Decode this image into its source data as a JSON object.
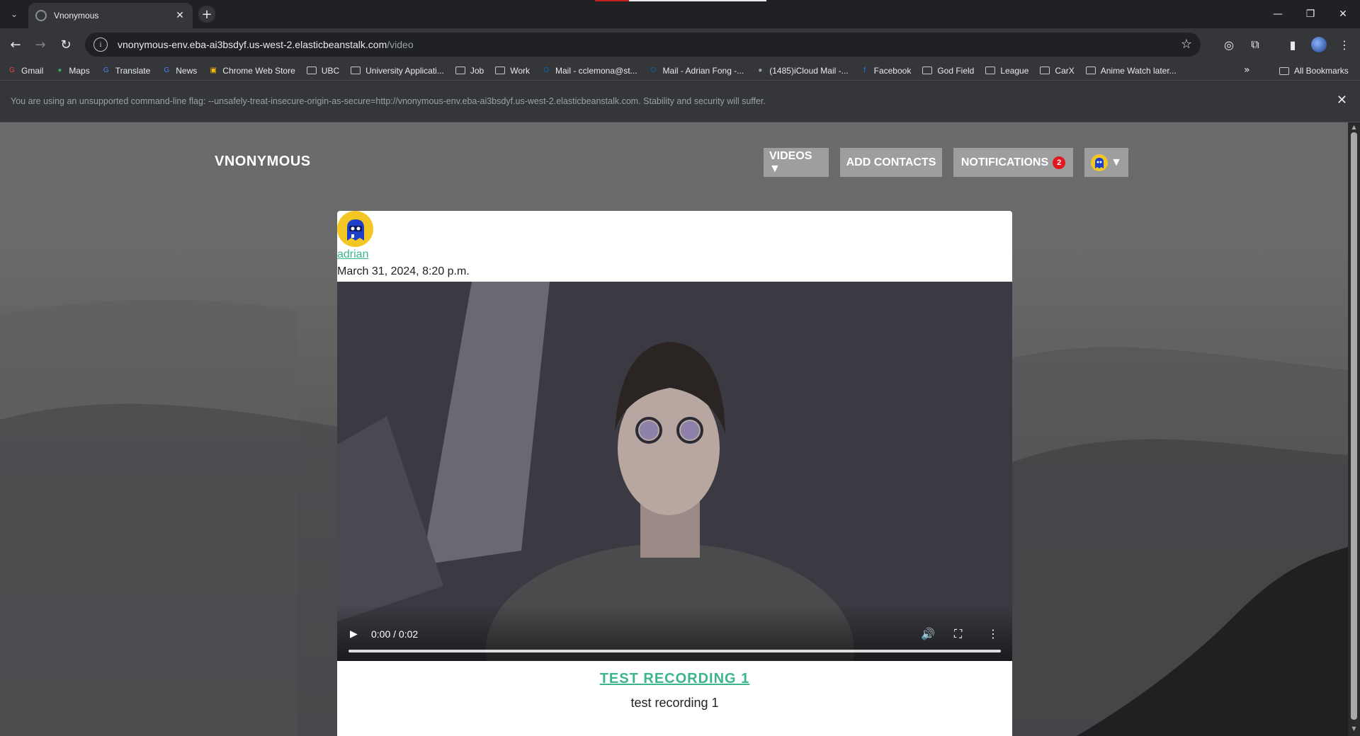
{
  "browser": {
    "tab_title": "Vnonymous",
    "tab_close": "✕",
    "new_tab": "+",
    "url_host": "vnonymous-env.eba-ai3bsdyf.us-west-2.elasticbeanstalk.com",
    "url_path": "/video",
    "bookmarks": [
      {
        "label": "Gmail",
        "icon": "gmail-icon",
        "color": "#ea4335",
        "glyph": "G"
      },
      {
        "label": "Maps",
        "icon": "maps-icon",
        "color": "#34a853",
        "glyph": "●"
      },
      {
        "label": "Translate",
        "icon": "translate-icon",
        "color": "#4285f4",
        "glyph": "G"
      },
      {
        "label": "News",
        "icon": "news-icon",
        "color": "#4285f4",
        "glyph": "G"
      },
      {
        "label": "Chrome Web Store",
        "icon": "webstore-icon",
        "color": "#fbbc04",
        "glyph": "▣"
      },
      {
        "label": "UBC",
        "icon": "folder-icon",
        "folder": true
      },
      {
        "label": "University Applicati...",
        "icon": "folder-icon",
        "folder": true
      },
      {
        "label": "Job",
        "icon": "folder-icon",
        "folder": true
      },
      {
        "label": "Work",
        "icon": "folder-icon",
        "folder": true
      },
      {
        "label": "Mail - cclemona@st...",
        "icon": "outlook-icon",
        "color": "#0a64ad",
        "glyph": "O"
      },
      {
        "label": "Mail - Adrian Fong -...",
        "icon": "outlook-icon",
        "color": "#0a64ad",
        "glyph": "O"
      },
      {
        "label": "(1485)iCloud Mail -...",
        "icon": "apple-icon",
        "color": "#9aa0a6",
        "glyph": "●"
      },
      {
        "label": "Facebook",
        "icon": "facebook-icon",
        "color": "#1877f2",
        "glyph": "f"
      },
      {
        "label": "God Field",
        "icon": "folder-icon",
        "folder": true
      },
      {
        "label": "League",
        "icon": "folder-icon",
        "folder": true
      },
      {
        "label": "CarX",
        "icon": "folder-icon",
        "folder": true
      },
      {
        "label": "Anime Watch later...",
        "icon": "folder-icon",
        "folder": true
      }
    ],
    "bookmarks_more": "»",
    "all_bookmarks": "All Bookmarks",
    "infobar_text": "You are using an unsupported command-line flag: --unsafely-treat-insecure-origin-as-secure=http://vnonymous-env.eba-ai3bsdyf.us-west-2.elasticbeanstalk.com. Stability and security will suffer.",
    "infobar_close": "✕"
  },
  "site": {
    "brand": "VNONYMOUS",
    "nav": {
      "videos": "VIDEOS ▼",
      "add_contacts": "ADD CONTACTS",
      "notifications": "NOTIFICATIONS",
      "notifications_count": "2",
      "profile_caret": "▼"
    }
  },
  "post": {
    "author": "adrian",
    "date": "March 31, 2024, 8:20 p.m.",
    "video_time": "0:00 / 0:02",
    "video_progress": 0,
    "title": "TEST RECORDING 1",
    "description": "test recording 1"
  },
  "colors": {
    "accent_link": "#3cb58e",
    "nav_button": "#9e9e9e",
    "badge": "#e0191f"
  }
}
